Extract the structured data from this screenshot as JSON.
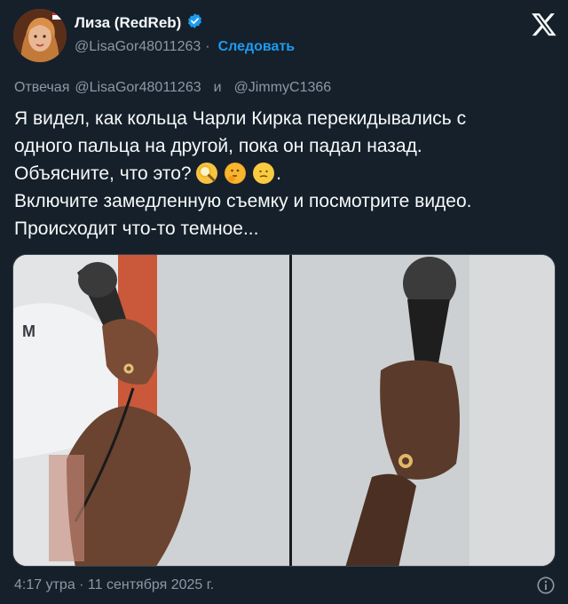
{
  "author": {
    "display_name": "Лиза (RedReb)",
    "handle": "@LisaGor48011263",
    "separator": "·",
    "follow_label": "Следовать"
  },
  "reply": {
    "prefix": "Отвечая",
    "mention1": "@LisaGor48011263",
    "and": "и",
    "mention2": "@JimmyC1366"
  },
  "text": {
    "line1": "Я видел, как кольца Чарли Кирка перекидывались с",
    "line2": "одного пальца на другой, пока он падал назад.",
    "line3": "Объясните, что это?",
    "line3_end": ".",
    "line4": "Включите замедленную съемку и посмотрите видео.",
    "line5": "Происходит что-то темное..."
  },
  "icons": {
    "verified": "verified-badge-icon",
    "x_logo": "x-logo-icon",
    "info": "info-icon",
    "emojis": [
      "magnifying-glass-emoji",
      "thinking-face-emoji",
      "confused-face-emoji"
    ]
  },
  "colors": {
    "background": "#15202b",
    "text": "#f7f9f9",
    "muted": "#8b98a5",
    "accent": "#1d9bf0"
  },
  "footer": {
    "timestamp": "4:17 утра · 11 сентября 2025 г."
  }
}
